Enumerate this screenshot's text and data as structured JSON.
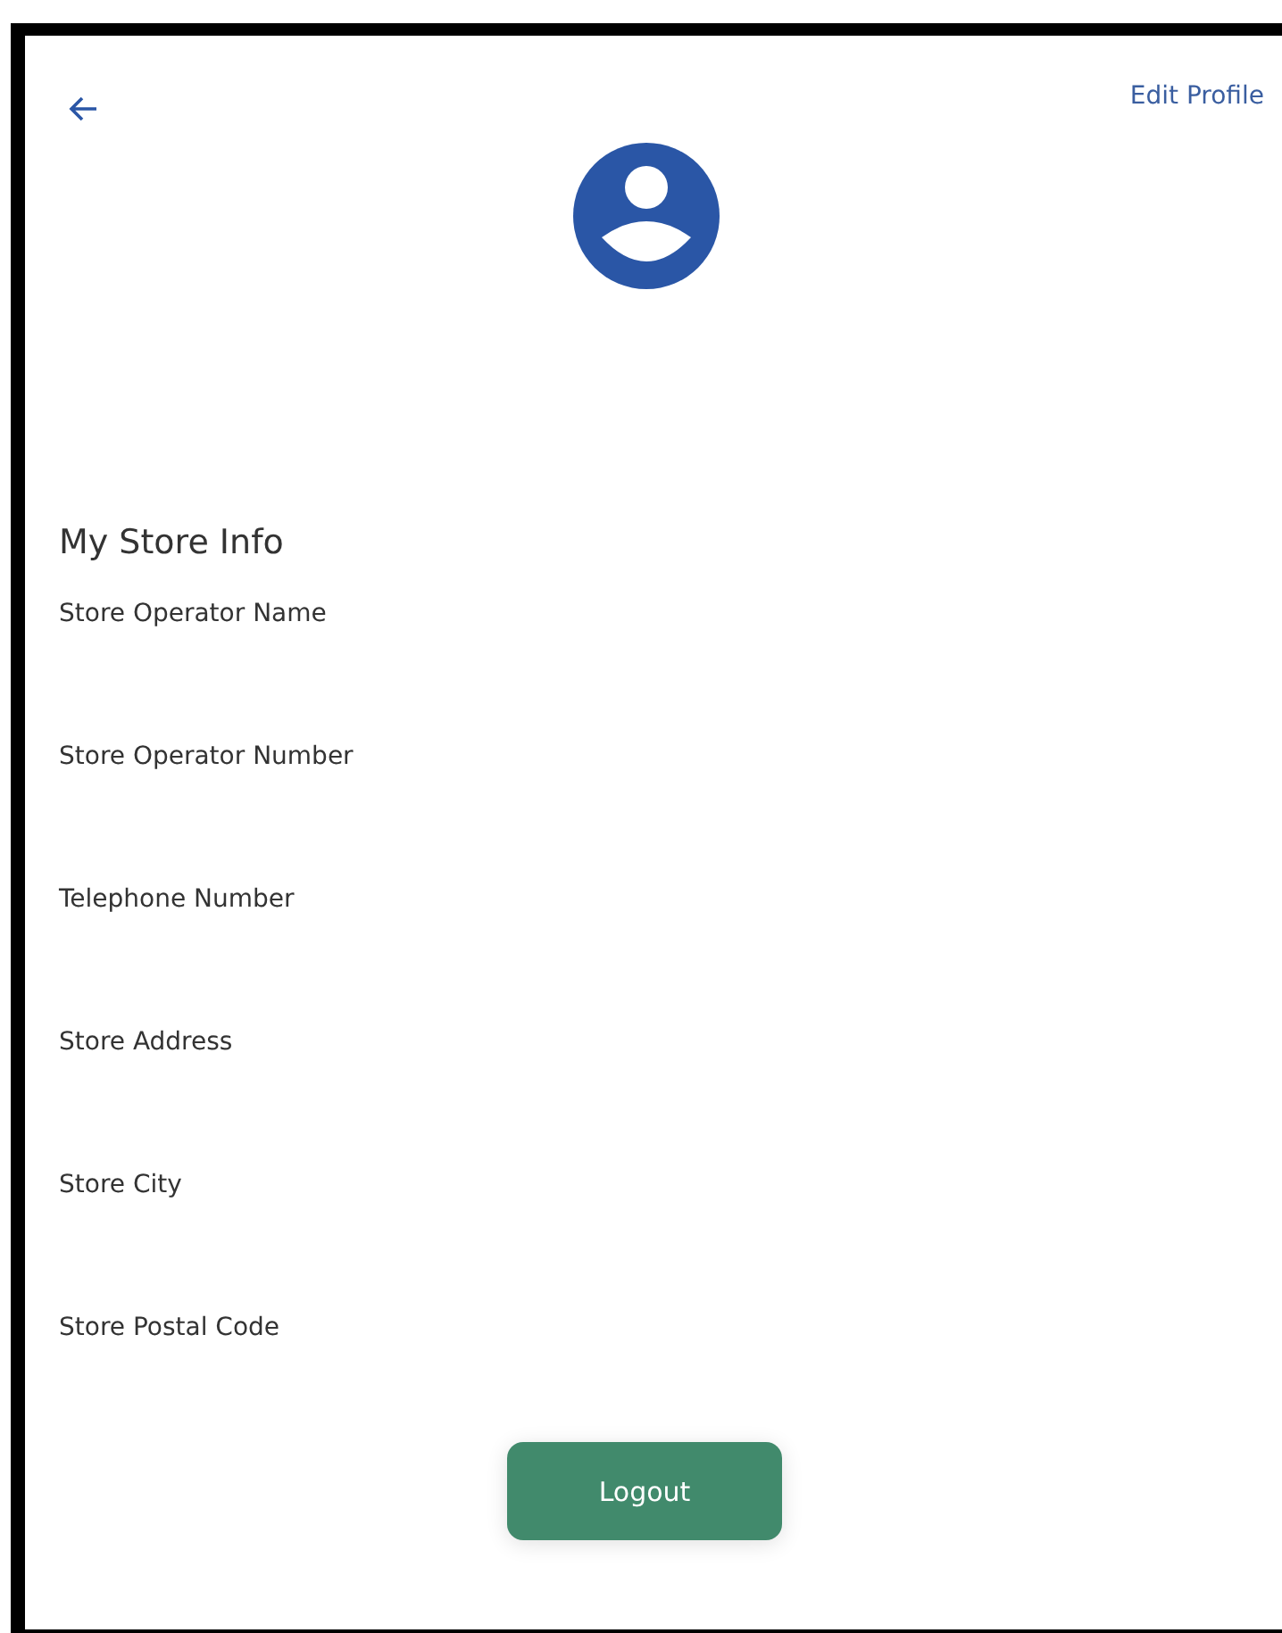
{
  "header": {
    "edit_link": "Edit Profile"
  },
  "section_title": "My Store Info",
  "fields": [
    {
      "label": "Store Operator Name"
    },
    {
      "label": "Store Operator Number"
    },
    {
      "label": "Telephone Number"
    },
    {
      "label": "Store Address"
    },
    {
      "label": "Store City"
    },
    {
      "label": "Store Postal Code"
    }
  ],
  "logout_button": "Logout"
}
